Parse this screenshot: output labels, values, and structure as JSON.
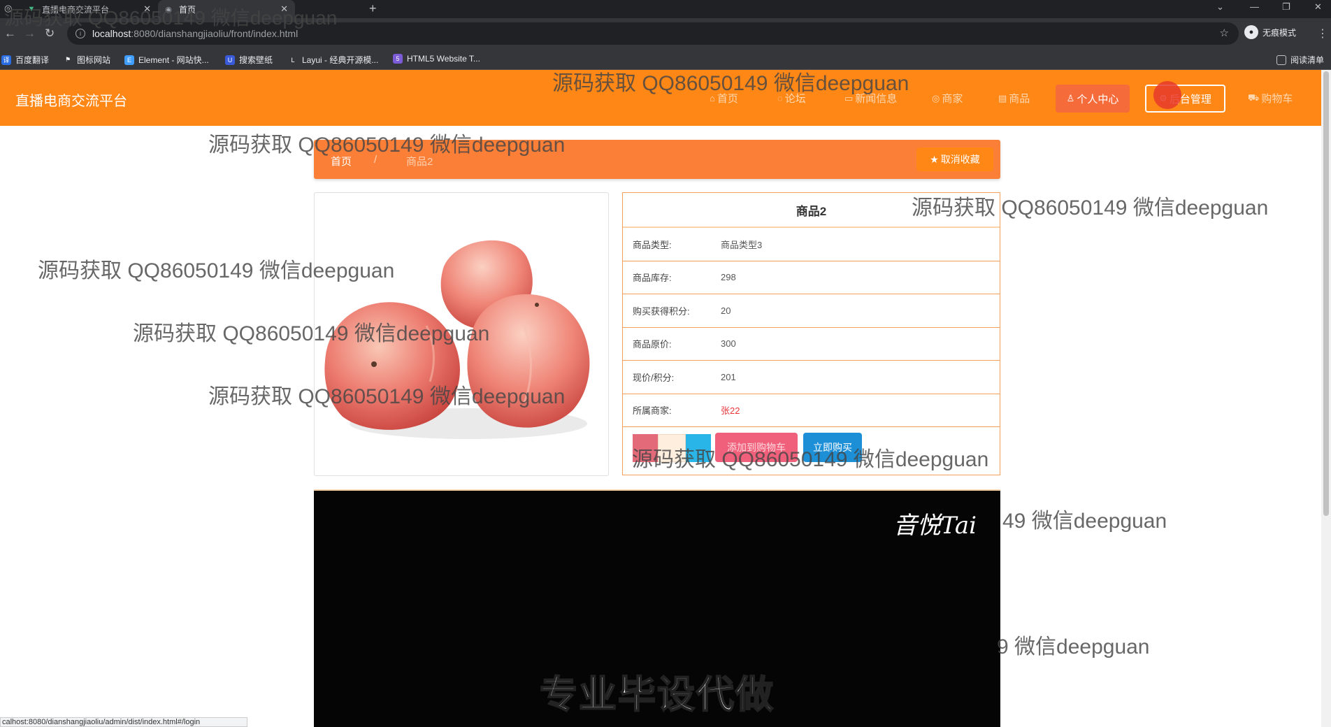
{
  "browser": {
    "tabs": [
      {
        "title": "直播电商交流平台",
        "icon": "vue-logo-icon"
      },
      {
        "title": "首页",
        "icon": "globe-icon"
      }
    ],
    "url_host": "localhost",
    "url_path": ":8080/dianshangjiaoliu/front/index.html",
    "incognito_label": "无痕模式",
    "bookmarks": [
      "百度翻译",
      "图标网站",
      "Element - 网站快...",
      "搜索壁纸",
      "Layui - 经典开源模...",
      "HTML5 Website T..."
    ],
    "reading_list": "阅读清单",
    "status_url": "calhost:8080/dianshangjiaoliu/admin/dist/index.html#/login"
  },
  "header": {
    "brand": "直播电商交流平台",
    "nav": [
      {
        "label": "首页",
        "icon": "home-icon"
      },
      {
        "label": "论坛",
        "icon": "chat-icon"
      },
      {
        "label": "新闻信息",
        "icon": "news-icon"
      },
      {
        "label": "商家",
        "icon": "shop-icon"
      },
      {
        "label": "商品",
        "icon": "goods-icon"
      }
    ],
    "personal_center": "个人中心",
    "admin": "后台管理",
    "cart": "购物车"
  },
  "breadcrumb": {
    "home": "首页",
    "sep": "/",
    "current": "商品2",
    "favorite_button": "取消收藏"
  },
  "product": {
    "name": "商品2",
    "fields": [
      {
        "label": "商品类型:",
        "value": "商品类型3"
      },
      {
        "label": "商品库存:",
        "value": "298"
      },
      {
        "label": "购买获得积分:",
        "value": "20"
      },
      {
        "label": "商品原价:",
        "value": "300"
      },
      {
        "label": "现价/积分:",
        "value": "201"
      },
      {
        "label": "所属商家:",
        "value": "张22"
      }
    ],
    "add_to_cart": "添加到购物车",
    "buy_now": "立即购买"
  },
  "video": {
    "logo": "音悦Tai",
    "caption": "专业毕设代做"
  },
  "watermarks": [
    "源码获取 QQ86050149 微信deepguan",
    "49 微信deepguan",
    "9 微信deepguan"
  ],
  "colors": {
    "header": "#ff8716",
    "breadcrumb": "#fb7f37",
    "cart_button": "#f0607a",
    "buy_button": "#1d8fd6",
    "merchant_value": "#e7353a"
  }
}
